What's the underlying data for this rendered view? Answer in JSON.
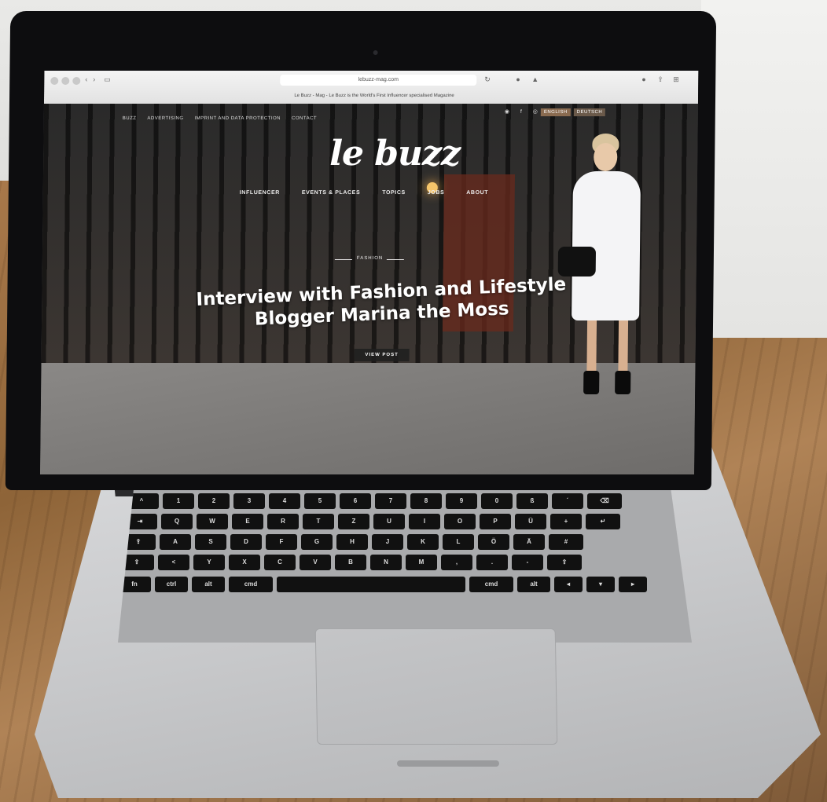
{
  "browser": {
    "url": "lebuzz-mag.com",
    "tab_title": "Le Buzz - Mag - Le Buzz is the World's First Influencer specialised Magazine"
  },
  "site": {
    "top_nav": [
      "BUZZ",
      "ADVERTISING",
      "IMPRINT AND DATA PROTECTION",
      "CONTACT"
    ],
    "languages": [
      "ENGLISH",
      "DEUTSCH"
    ],
    "logo": "le buzz",
    "main_nav": [
      "INFLUENCER",
      "EVENTS & PLACES",
      "TOPICS",
      "JOBS",
      "ABOUT"
    ],
    "hero": {
      "category": "FASHION",
      "headline": "Interview with Fashion and Lifestyle Blogger Marina the Moss",
      "cta": "VIEW POST"
    }
  },
  "keyboard": {
    "row2": [
      "^",
      "1",
      "2",
      "3",
      "4",
      "5",
      "6",
      "7",
      "8",
      "9",
      "0",
      "ß",
      "´",
      "⌫"
    ],
    "row3": [
      "⇥",
      "Q",
      "W",
      "E",
      "R",
      "T",
      "Z",
      "U",
      "I",
      "O",
      "P",
      "Ü",
      "+",
      "↵"
    ],
    "row4": [
      "⇪",
      "A",
      "S",
      "D",
      "F",
      "G",
      "H",
      "J",
      "K",
      "L",
      "Ö",
      "Ä",
      "#"
    ],
    "row5": [
      "⇧",
      "<",
      "Y",
      "X",
      "C",
      "V",
      "B",
      "N",
      "M",
      ",",
      ".",
      "-",
      "⇧"
    ]
  },
  "colors": {
    "desk": "#9a6e44",
    "laptop_silver": "#c7c8ca",
    "bezel": "#0d0d0f",
    "lang_button": "#8a6b50"
  }
}
